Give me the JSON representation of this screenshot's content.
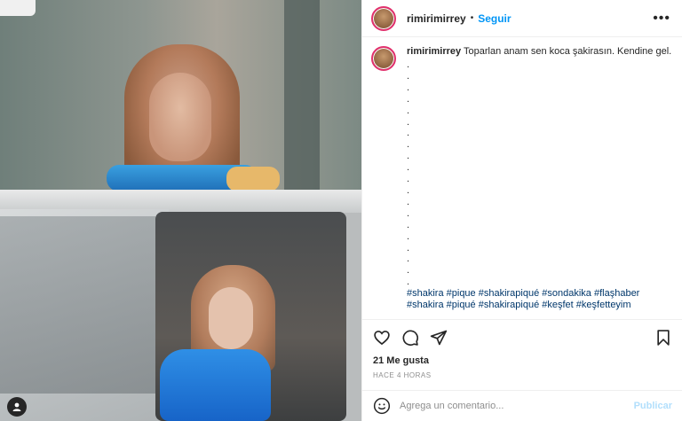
{
  "post": {
    "username": "rimirimirrey",
    "follow_label": "Seguir",
    "more_label": "•••",
    "caption_text": "Toparlan anam sen koca şakirasın. Kendine gel.",
    "caption_dots": [
      ".",
      ".",
      ".",
      ".",
      ".",
      ".",
      ".",
      ".",
      ".",
      ".",
      ".",
      ".",
      ".",
      ".",
      ".",
      ".",
      ".",
      ".",
      ".",
      "."
    ],
    "hashtags_line1": "#shakira #pique #shakirapiqué #sondakika #flaşhaber",
    "hashtags_line2": "#shakira #piqué #shakirapiqué #keşfet #keşfetteyim",
    "likes": "21 Me gusta",
    "time_ago": "HACE 4 HORAS"
  },
  "comment": {
    "placeholder": "Agrega un comentario...",
    "publish_label": "Publicar"
  },
  "colors": {
    "follow": "#0095f6",
    "publish_disabled": "#b2dffc",
    "hashtag": "#00376b"
  },
  "icons": [
    "heart-icon",
    "comment-icon",
    "share-icon",
    "bookmark-icon",
    "emoji-icon",
    "user-tag-icon",
    "more-icon"
  ]
}
